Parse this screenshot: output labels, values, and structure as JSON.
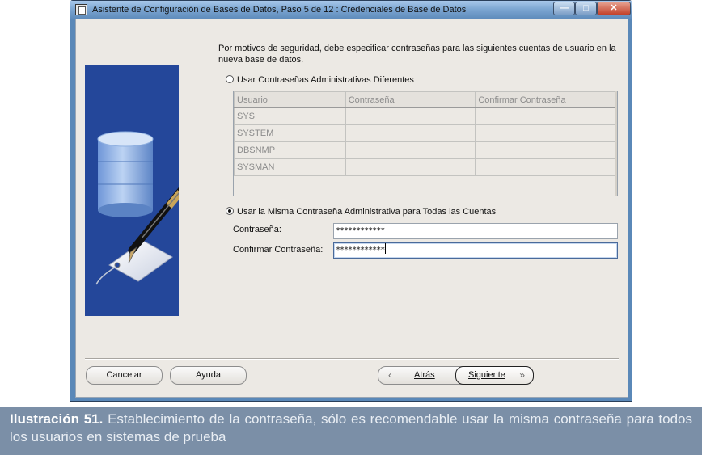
{
  "window": {
    "title": "Asistente de Configuración de Bases de Datos, Paso 5 de 12 : Credenciales de Base de Datos",
    "min_glyph": "—",
    "max_glyph": "□",
    "close_glyph": "✕"
  },
  "content": {
    "description": "Por motivos de seguridad, debe especificar contraseñas para las siguientes cuentas de usuario en la nueva base de datos.",
    "option_different": "Usar Contraseñas Administrativas Diferentes",
    "option_same": "Usar la Misma Contraseña Administrativa para Todas las Cuentas",
    "selected_option": "same"
  },
  "table": {
    "columns": [
      "Usuario",
      "Contraseña",
      "Confirmar Contraseña"
    ],
    "rows": [
      [
        "SYS",
        "",
        ""
      ],
      [
        "SYSTEM",
        "",
        ""
      ],
      [
        "DBSNMP",
        "",
        ""
      ],
      [
        "SYSMAN",
        "",
        ""
      ]
    ]
  },
  "fields": {
    "password_label": "Contraseña:",
    "password_value": "************",
    "confirm_label": "Confirmar Contraseña:",
    "confirm_value": "************"
  },
  "buttons": {
    "cancel": "Cancelar",
    "help": "Ayuda",
    "back": "Atrás",
    "next": "Siguiente"
  },
  "caption": {
    "label": "Ilustración 51.",
    "text": "Establecimiento de la contraseña, sólo es recomendable usar la misma contraseña para todos los usuarios en sistemas de prueba"
  },
  "colors": {
    "side_image_bg": "#24479a",
    "caption_bg": "#7b8fa7",
    "dialog_bg": "#ece9e4"
  }
}
